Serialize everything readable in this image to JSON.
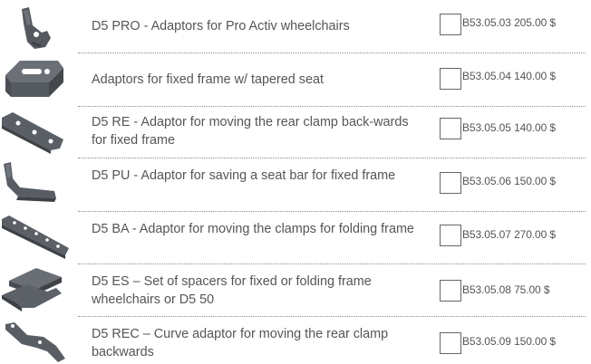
{
  "products": [
    {
      "image": "wheelchair-adaptor-pro-activ-icon",
      "description": "D5 PRO - Adaptors for Pro Activ wheelchairs",
      "code": "B53.05.03",
      "price": "205.00 $"
    },
    {
      "image": "fixed-frame-adaptor-icon",
      "description": "Adaptors for fixed frame w/ tapered seat",
      "code": "B53.05.04",
      "price": "140.00 $"
    },
    {
      "image": "rear-clamp-adaptor-icon",
      "description": "D5 RE - Adaptor for moving the rear clamp back-wards for fixed frame",
      "code": "B53.05.05",
      "price": "140.00 $"
    },
    {
      "image": "seat-bar-adaptor-icon",
      "description": "D5 PU - Adaptor for saving a seat bar for fixed frame",
      "code": "B53.05.06",
      "price": "150.00 $"
    },
    {
      "image": "folding-clamp-adaptor-icon",
      "description": "D5 BA - Adaptor for moving the clamps for folding frame",
      "code": "B53.05.07",
      "price": "270.00 $"
    },
    {
      "image": "spacer-set-icon",
      "description": "D5 ES – Set of spacers for fixed or folding frame wheelchairs or D5 50",
      "code": "B53.05.08",
      "price": "75.00 $"
    },
    {
      "image": "curve-adaptor-icon",
      "description": "D5 REC – Curve adaptor for moving the rear clamp backwards",
      "code": "B53.05.09",
      "price": "150.00 $"
    }
  ]
}
